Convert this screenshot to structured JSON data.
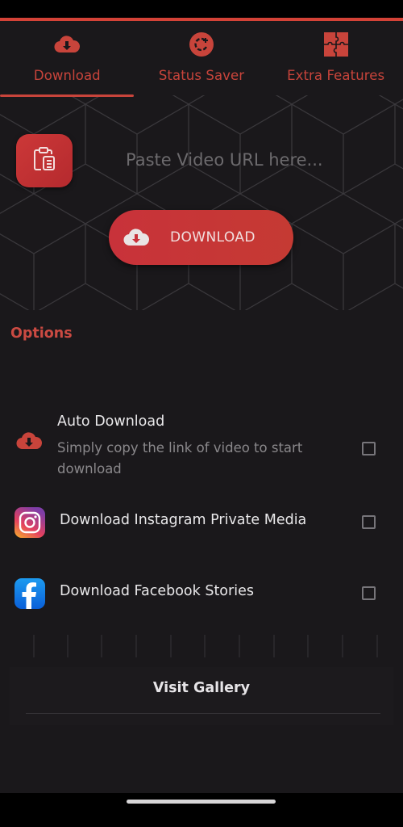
{
  "tabs": [
    {
      "label": "Download",
      "icon": "cloud-download-icon",
      "active": true
    },
    {
      "label": "Status Saver",
      "icon": "status-refresh-icon",
      "active": false
    },
    {
      "label": "Extra Features",
      "icon": "puzzle-icon",
      "active": false
    }
  ],
  "url_input": {
    "placeholder": "Paste Video URL here...",
    "value": ""
  },
  "paste_button": {
    "icon": "clipboard-icon"
  },
  "download_button": {
    "label": "DOWNLOAD",
    "icon": "cloud-download-icon"
  },
  "options": {
    "title": "Options",
    "items": [
      {
        "title": "Auto Download",
        "description": "Simply copy the link of video to start download",
        "icon": "cloud-download-icon",
        "checked": false
      },
      {
        "title": "Download Instagram Private Media",
        "icon": "instagram-icon",
        "checked": false
      },
      {
        "title": "Download Facebook Stories",
        "icon": "facebook-icon",
        "checked": false
      }
    ]
  },
  "gallery": {
    "label": "Visit Gallery"
  },
  "colors": {
    "accent": "#c8443b",
    "background": "#1a181b",
    "button": "#c8323a"
  }
}
